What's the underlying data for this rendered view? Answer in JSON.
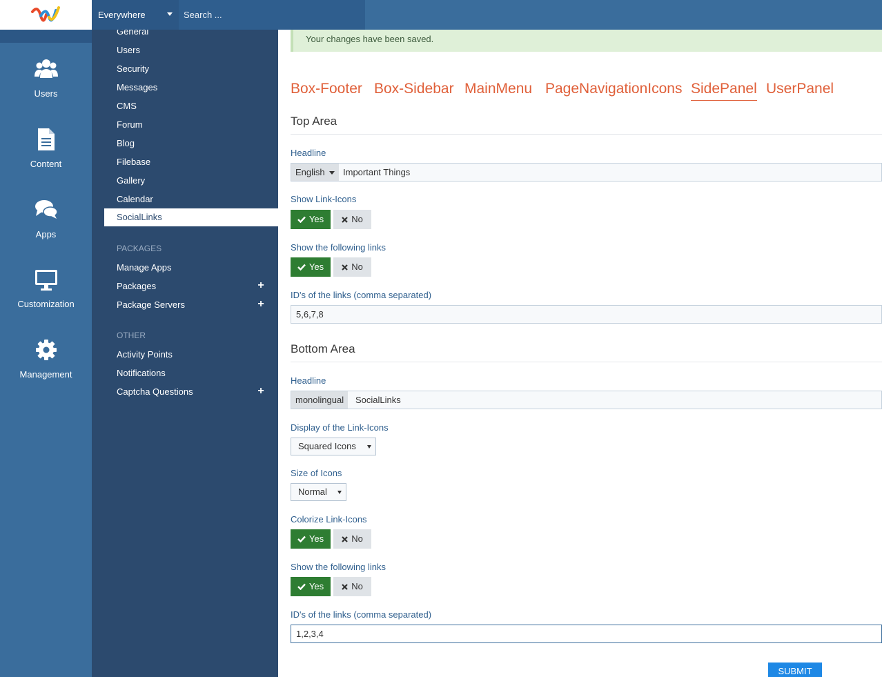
{
  "header": {
    "search_scope": "Everywhere",
    "search_placeholder": "Search ..."
  },
  "main_menu": [
    {
      "label": "Users",
      "icon": "users-icon"
    },
    {
      "label": "Content",
      "icon": "document-icon"
    },
    {
      "label": "Apps",
      "icon": "chat-icon"
    },
    {
      "label": "Customization",
      "icon": "monitor-icon"
    },
    {
      "label": "Management",
      "icon": "gear-icon"
    }
  ],
  "submenu": {
    "items": [
      "General",
      "Users",
      "Security",
      "Messages",
      "CMS",
      "Forum",
      "Blog",
      "Filebase",
      "Gallery",
      "Calendar",
      "SocialLinks"
    ],
    "active": "SocialLinks",
    "packages_heading": "PACKAGES",
    "packages": [
      "Manage Apps",
      "Packages",
      "Package Servers"
    ],
    "other_heading": "OTHER",
    "other": [
      "Activity Points",
      "Notifications",
      "Captcha Questions"
    ]
  },
  "notice": "Your changes have been saved.",
  "tabs": [
    "Box-Footer",
    "Box-Sidebar",
    "MainMenu",
    "PageNavigationIcons",
    "SidePanel",
    "UserPanel"
  ],
  "active_tab": "SidePanel",
  "top_area": {
    "title": "Top Area",
    "headline_label": "Headline",
    "headline_language": "English",
    "headline_value": "Important Things",
    "show_icons_label": "Show Link-Icons",
    "show_links_label": "Show the following links",
    "ids_label": "ID's of the links (comma separated)",
    "ids_value": "5,6,7,8"
  },
  "bottom_area": {
    "title": "Bottom Area",
    "headline_label": "Headline",
    "headline_language": "monolingual",
    "headline_value": "SocialLinks",
    "display_label": "Display of the Link-Icons",
    "display_value": "Squared Icons",
    "size_label": "Size of Icons",
    "size_value": "Normal",
    "colorize_label": "Colorize Link-Icons",
    "show_links_label": "Show the following links",
    "ids_label": "ID's of the links (comma separated)",
    "ids_value": "1,2,3,4"
  },
  "toggle": {
    "yes": "Yes",
    "no": "No"
  },
  "submit_label": "Submit",
  "colors": {
    "accent": "#e0603a",
    "sidebar": "#2c4a6e",
    "primary": "#3a6d9c",
    "yes": "#2e7d32"
  }
}
